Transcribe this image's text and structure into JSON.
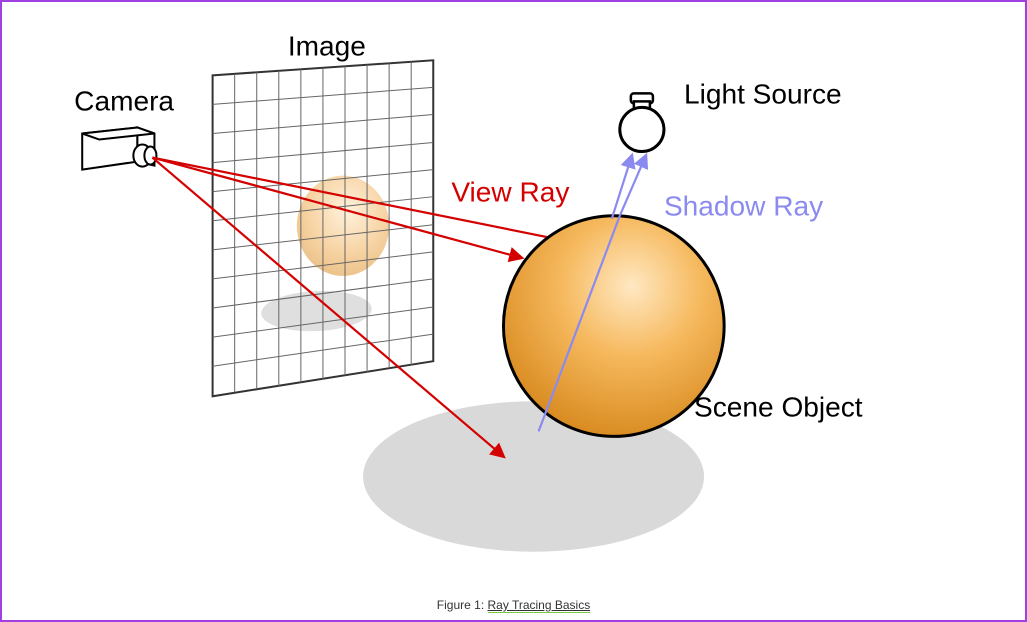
{
  "labels": {
    "camera": "Camera",
    "image": "Image",
    "view_ray": "View Ray",
    "shadow_ray": "Shadow Ray",
    "light_source": "Light Source",
    "scene_object": "Scene Object"
  },
  "caption": {
    "prefix": "Figure 1: ",
    "link_text": "Ray Tracing Basics"
  },
  "colors": {
    "view_ray": "#d40000",
    "shadow_ray": "#8a8af0",
    "sphere_fill": "#f2a642",
    "sphere_highlight": "#ffe4b5",
    "shadow_fill": "#d9d9d9",
    "grid_stroke": "#666666",
    "outline": "#000000"
  },
  "diagram": {
    "description": "Ray tracing schematic: camera emits view rays through image plane pixels toward scene sphere; shadow ray from hit point toward light source; cast shadow on ground.",
    "components": [
      "camera",
      "image_plane_grid",
      "view_rays",
      "scene_sphere",
      "ground_shadow",
      "shadow_ray",
      "light_source_bulb"
    ]
  }
}
